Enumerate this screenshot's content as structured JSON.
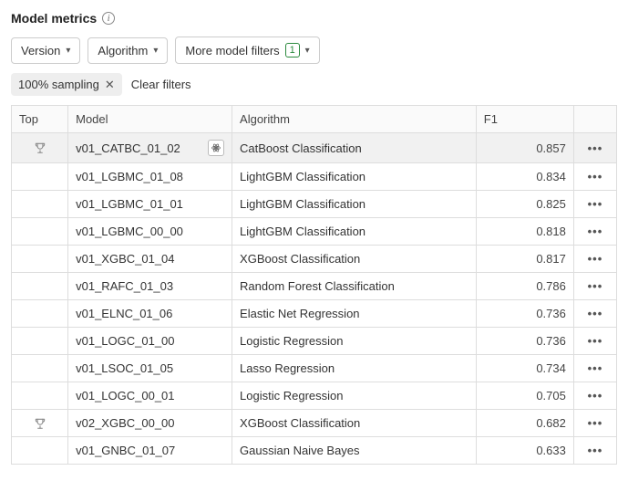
{
  "title": "Model metrics",
  "filters": {
    "version_label": "Version",
    "algorithm_label": "Algorithm",
    "more_label": "More model filters",
    "more_count": "1"
  },
  "chips": {
    "sampling": "100% sampling",
    "clear": "Clear filters"
  },
  "columns": {
    "top": "Top",
    "model": "Model",
    "algorithm": "Algorithm",
    "f1": "F1"
  },
  "rows": [
    {
      "top": true,
      "model": "v01_CATBC_01_02",
      "algorithm": "CatBoost Classification",
      "f1": "0.857",
      "selected": true,
      "atom": true
    },
    {
      "top": false,
      "model": "v01_LGBMC_01_08",
      "algorithm": "LightGBM Classification",
      "f1": "0.834",
      "selected": false,
      "atom": false
    },
    {
      "top": false,
      "model": "v01_LGBMC_01_01",
      "algorithm": "LightGBM Classification",
      "f1": "0.825",
      "selected": false,
      "atom": false
    },
    {
      "top": false,
      "model": "v01_LGBMC_00_00",
      "algorithm": "LightGBM Classification",
      "f1": "0.818",
      "selected": false,
      "atom": false
    },
    {
      "top": false,
      "model": "v01_XGBC_01_04",
      "algorithm": "XGBoost Classification",
      "f1": "0.817",
      "selected": false,
      "atom": false
    },
    {
      "top": false,
      "model": "v01_RAFC_01_03",
      "algorithm": "Random Forest Classification",
      "f1": "0.786",
      "selected": false,
      "atom": false
    },
    {
      "top": false,
      "model": "v01_ELNC_01_06",
      "algorithm": "Elastic Net Regression",
      "f1": "0.736",
      "selected": false,
      "atom": false
    },
    {
      "top": false,
      "model": "v01_LOGC_01_00",
      "algorithm": "Logistic Regression",
      "f1": "0.736",
      "selected": false,
      "atom": false
    },
    {
      "top": false,
      "model": "v01_LSOC_01_05",
      "algorithm": "Lasso Regression",
      "f1": "0.734",
      "selected": false,
      "atom": false
    },
    {
      "top": false,
      "model": "v01_LOGC_00_01",
      "algorithm": "Logistic Regression",
      "f1": "0.705",
      "selected": false,
      "atom": false
    },
    {
      "top": true,
      "model": "v02_XGBC_00_00",
      "algorithm": "XGBoost Classification",
      "f1": "0.682",
      "selected": false,
      "atom": false
    },
    {
      "top": false,
      "model": "v01_GNBC_01_07",
      "algorithm": "Gaussian Naive Bayes",
      "f1": "0.633",
      "selected": false,
      "atom": false
    }
  ]
}
